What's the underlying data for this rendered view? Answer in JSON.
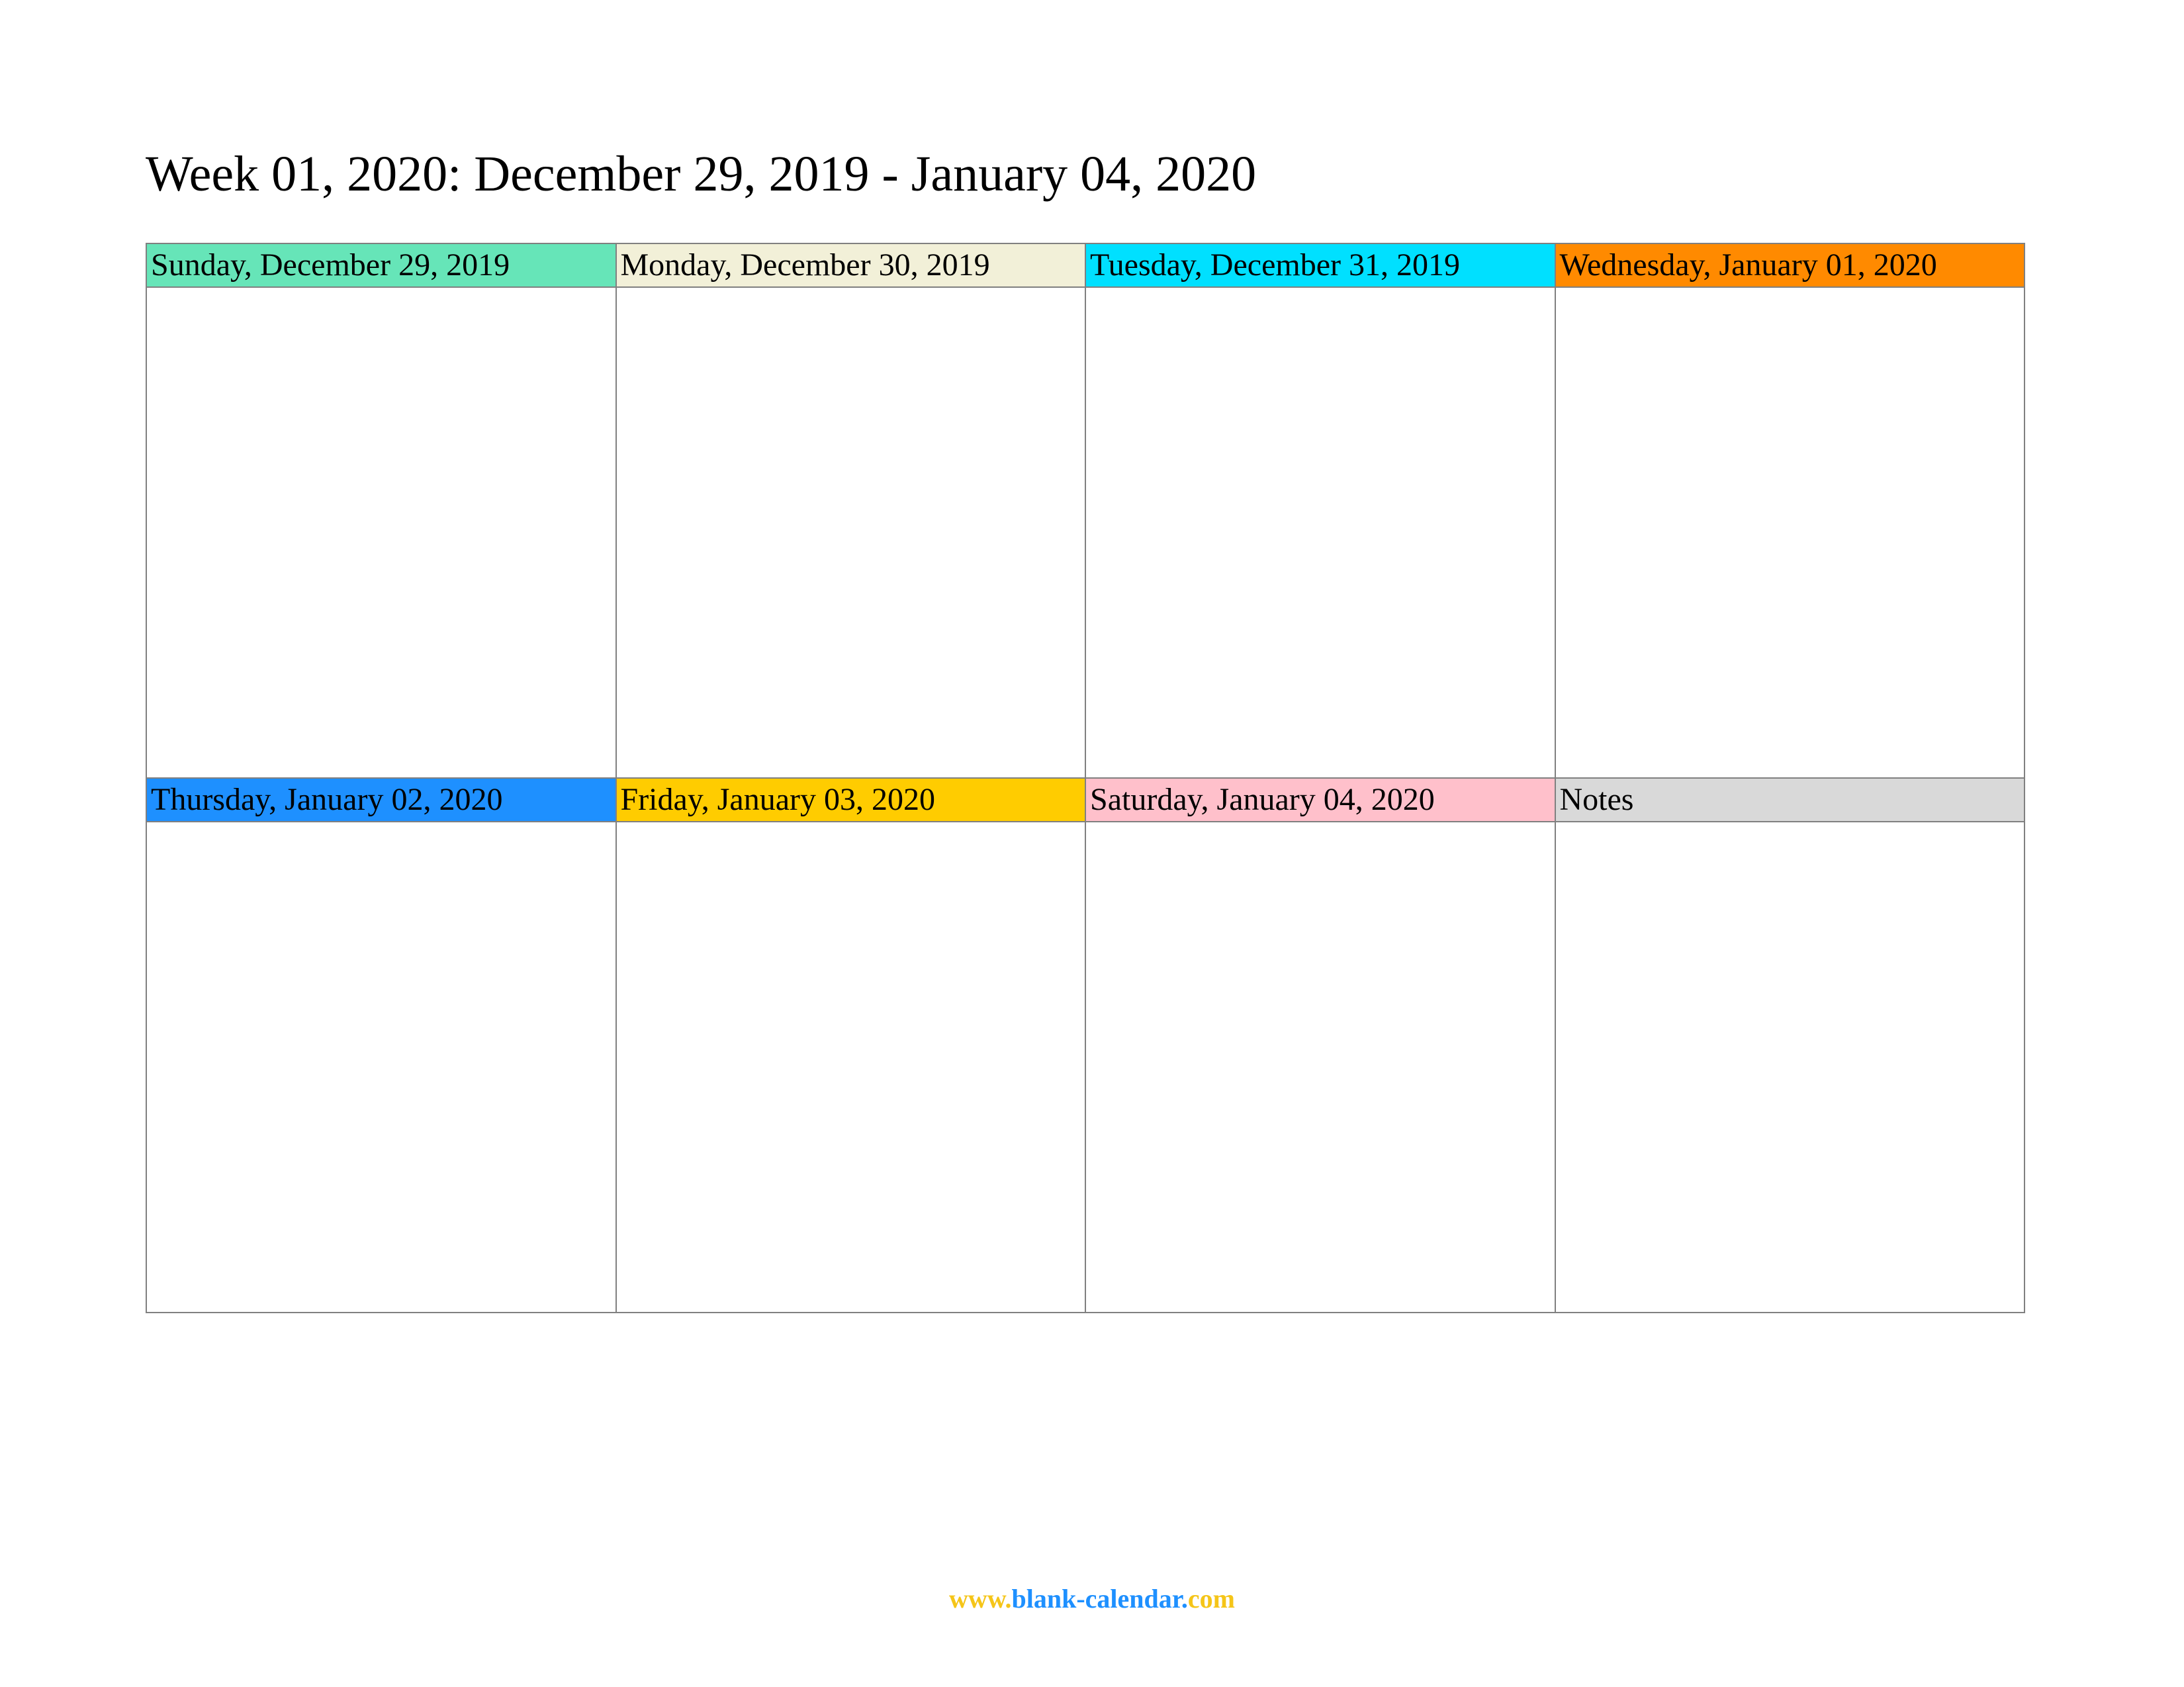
{
  "title": "Week 01, 2020: December 29, 2019 - January 04, 2020",
  "cells": [
    {
      "label": "Sunday, December 29, 2019",
      "color": "#66e5b8"
    },
    {
      "label": "Monday, December 30, 2019",
      "color": "#f2f0d8"
    },
    {
      "label": "Tuesday, December 31, 2019",
      "color": "#00e0ff"
    },
    {
      "label": "Wednesday, January 01, 2020",
      "color": "#ff8a00"
    },
    {
      "label": "Thursday, January 02, 2020",
      "color": "#1e90ff"
    },
    {
      "label": "Friday, January 03, 2020",
      "color": "#ffcc00"
    },
    {
      "label": "Saturday, January 04, 2020",
      "color": "#ffc0cb"
    },
    {
      "label": "Notes",
      "color": "#d9d9d9"
    }
  ],
  "footer": {
    "www": "www.",
    "mid": "blank-calendar.",
    "com": "com"
  }
}
